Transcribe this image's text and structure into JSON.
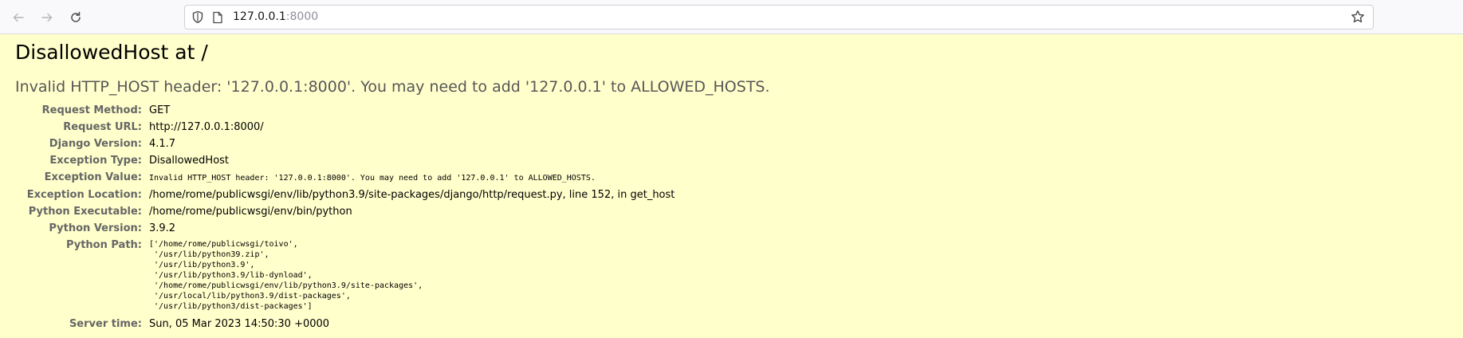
{
  "browser": {
    "url_host": "127.0.0.1",
    "url_port": ":8000"
  },
  "error": {
    "title": "DisallowedHost at /",
    "message": "Invalid HTTP_HOST header: '127.0.0.1:8000'. You may need to add '127.0.0.1' to ALLOWED_HOSTS."
  },
  "meta": [
    {
      "label": "Request Method:",
      "value": "GET"
    },
    {
      "label": "Request URL:",
      "value": "http://127.0.0.1:8000/"
    },
    {
      "label": "Django Version:",
      "value": "4.1.7"
    },
    {
      "label": "Exception Type:",
      "value": "DisallowedHost"
    },
    {
      "label": "Exception Value:",
      "value": "Invalid HTTP_HOST header: '127.0.0.1:8000'. You may need to add '127.0.0.1' to ALLOWED_HOSTS."
    },
    {
      "label": "Exception Location:",
      "value": "/home/rome/publicwsgi/env/lib/python3.9/site-packages/django/http/request.py, line 152, in get_host"
    },
    {
      "label": "Python Executable:",
      "value": "/home/rome/publicwsgi/env/bin/python"
    },
    {
      "label": "Python Version:",
      "value": "3.9.2"
    },
    {
      "label": "Python Path:",
      "value": "['/home/rome/publicwsgi/toivo',\n '/usr/lib/python39.zip',\n '/usr/lib/python3.9',\n '/usr/lib/python3.9/lib-dynload',\n '/home/rome/publicwsgi/env/lib/python3.9/site-packages',\n '/usr/local/lib/python3.9/dist-packages',\n '/usr/lib/python3/dist-packages']"
    },
    {
      "label": "Server time:",
      "value": "Sun, 05 Mar 2023 14:50:30 +0000"
    }
  ]
}
